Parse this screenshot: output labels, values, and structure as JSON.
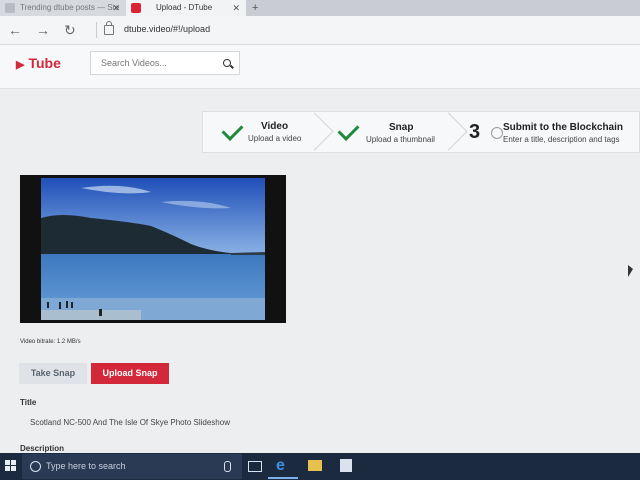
{
  "browser": {
    "tabs": [
      {
        "label": "Trending dtube posts — Ste",
        "active": false
      },
      {
        "label": "Upload - DTube",
        "active": true
      }
    ],
    "url": "dtube.video/#!/upload"
  },
  "header": {
    "logo_text": "Tube",
    "search_placeholder": "Search Videos..."
  },
  "steps": [
    {
      "title": "Video",
      "subtitle": "Upload a video",
      "status": "done"
    },
    {
      "title": "Snap",
      "subtitle": "Upload a thumbnail",
      "status": "done"
    },
    {
      "number": "3",
      "title": "Submit to the Blockchain",
      "subtitle": "Enter a title, description and tags",
      "status": "current"
    }
  ],
  "video": {
    "bitrate_text": "Video bitrate: 1.2 MB/s"
  },
  "buttons": {
    "take_snap": "Take Snap",
    "upload_snap": "Upload Snap"
  },
  "form": {
    "title_label": "Title",
    "title_value": "Scotland NC-500 And The Isle Of Skye Photo Slideshow",
    "description_label": "Description"
  },
  "taskbar": {
    "search_placeholder": "Type here to search"
  },
  "colors": {
    "brand": "#d3283a",
    "check": "#1f8a3b",
    "taskbar": "#1c2a3f"
  }
}
